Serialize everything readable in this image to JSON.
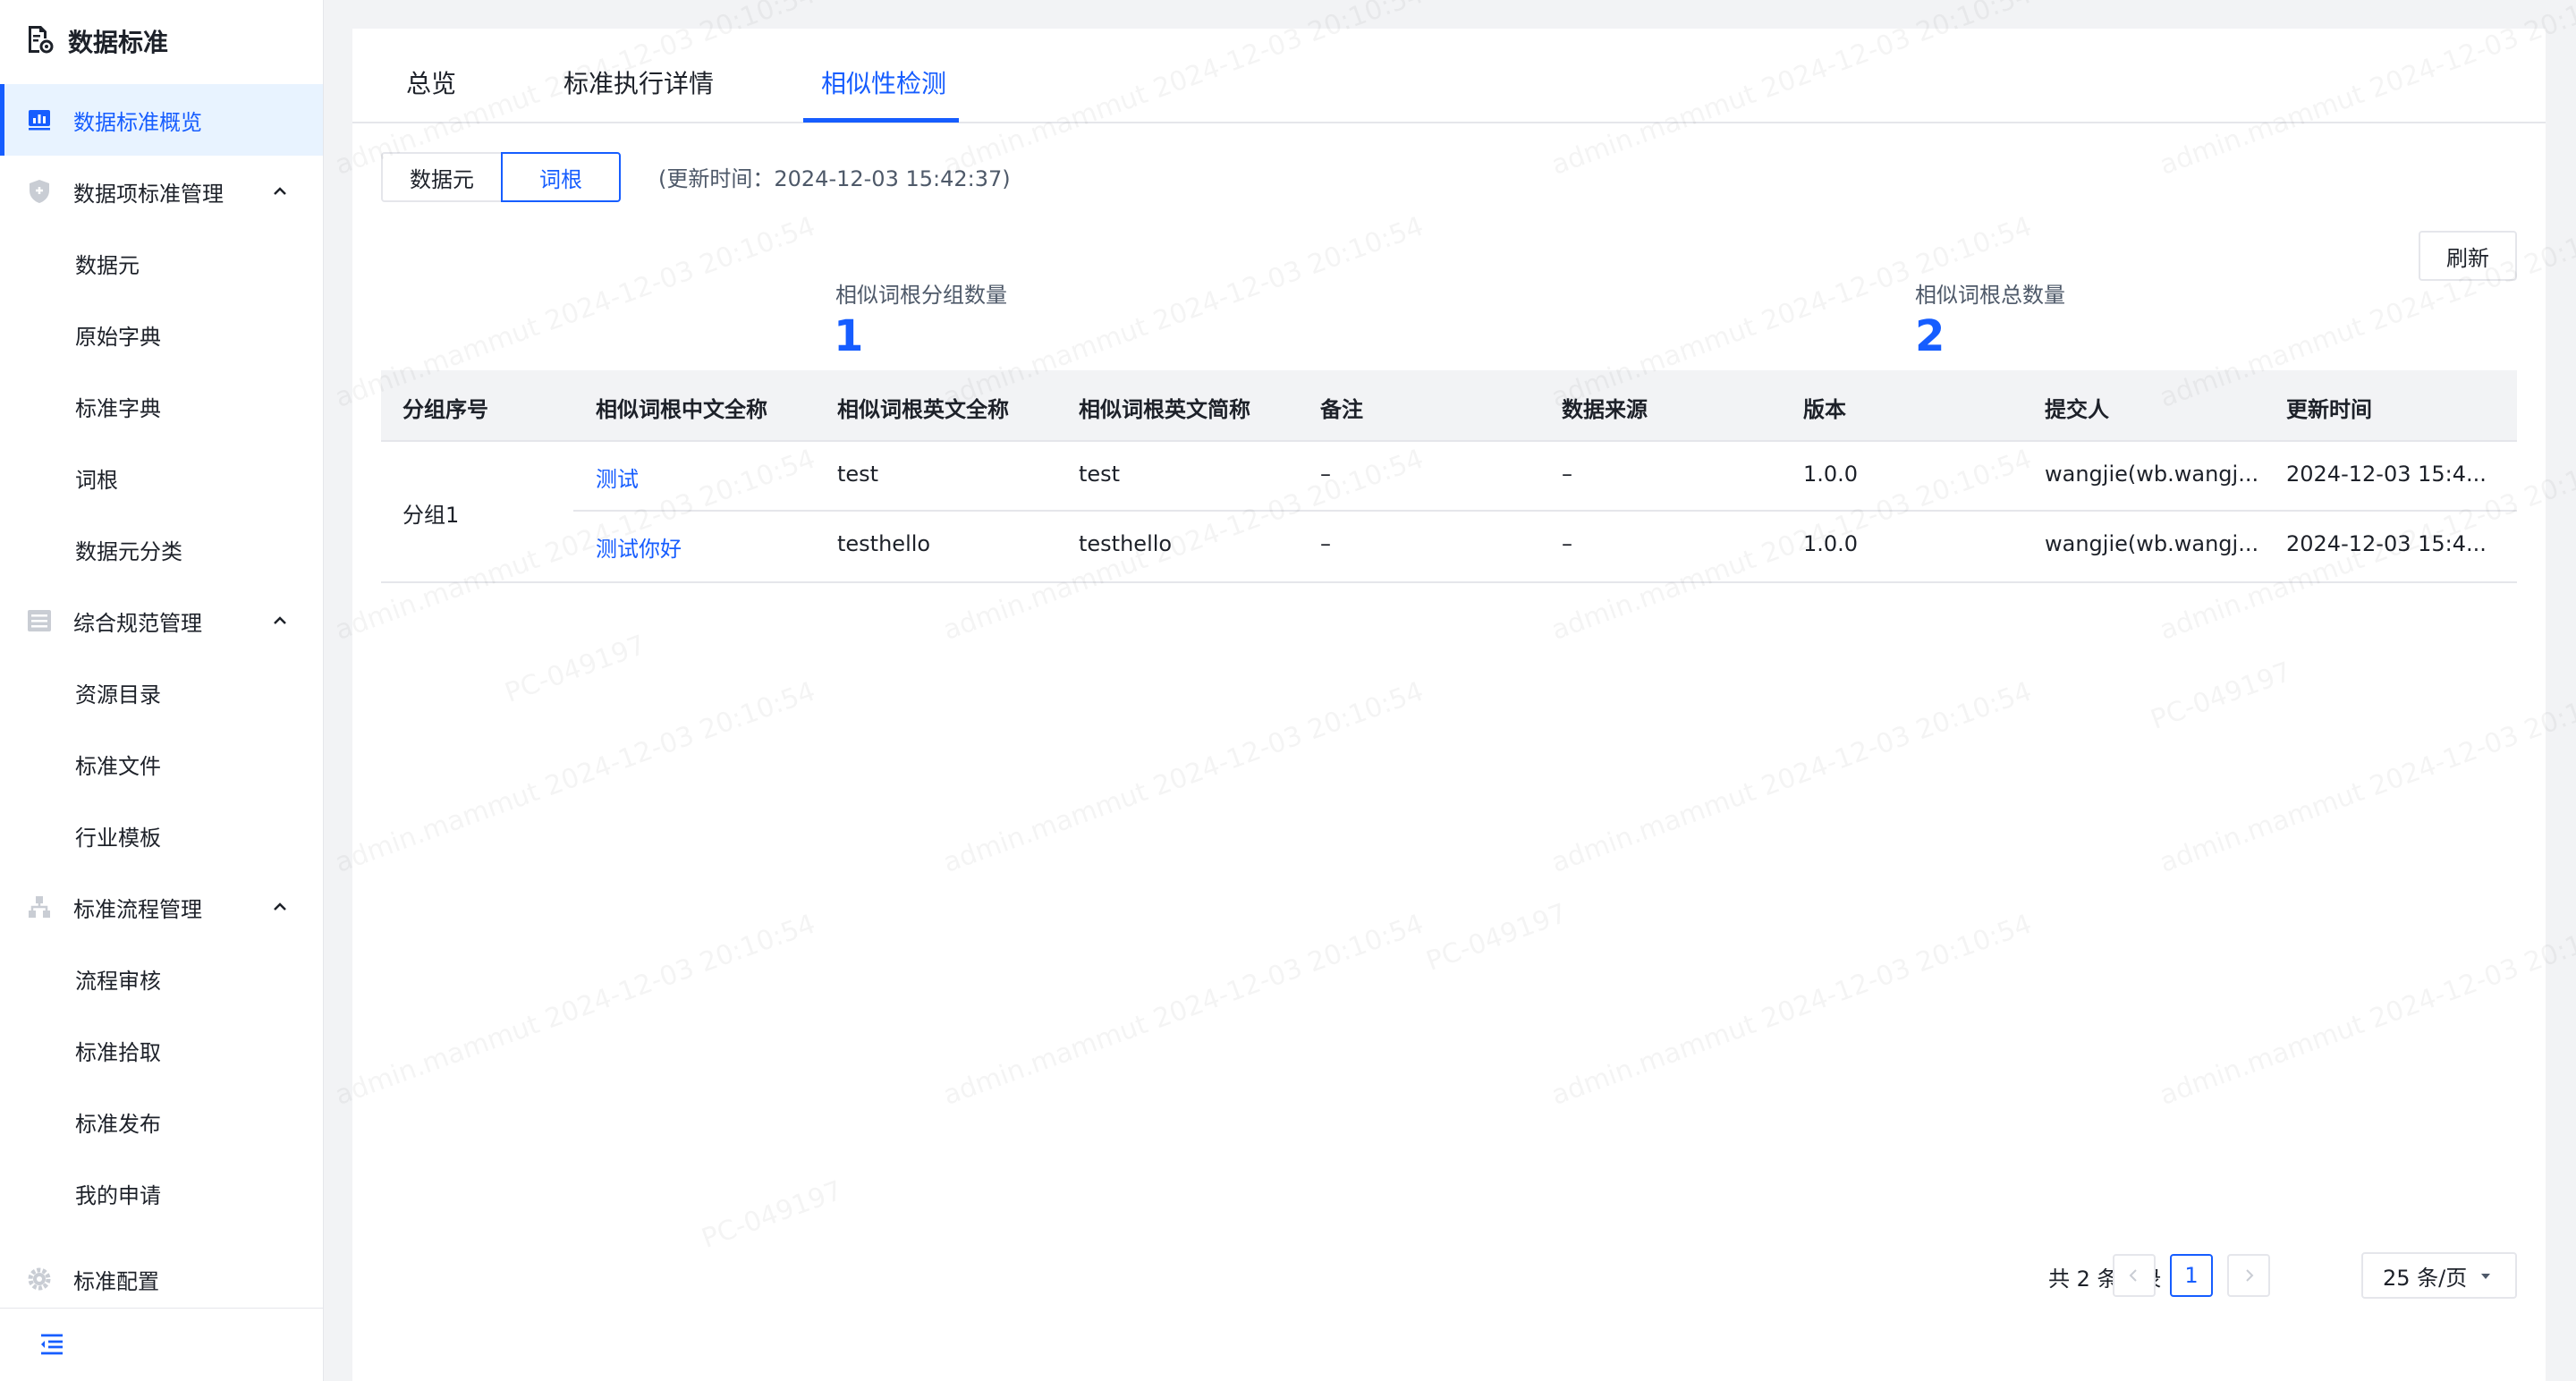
{
  "app": {
    "title": "数据标准"
  },
  "sidebar": {
    "items": [
      {
        "label": "数据标准概览",
        "type": "top",
        "icon": "chart-board-icon",
        "active": true
      },
      {
        "label": "数据项标准管理",
        "type": "group",
        "icon": "shield-icon"
      },
      {
        "label": "数据元",
        "type": "sub"
      },
      {
        "label": "原始字典",
        "type": "sub"
      },
      {
        "label": "标准字典",
        "type": "sub"
      },
      {
        "label": "词根",
        "type": "sub"
      },
      {
        "label": "数据元分类",
        "type": "sub"
      },
      {
        "label": "综合规范管理",
        "type": "group",
        "icon": "list-icon"
      },
      {
        "label": "资源目录",
        "type": "sub"
      },
      {
        "label": "标准文件",
        "type": "sub"
      },
      {
        "label": "行业模板",
        "type": "sub"
      },
      {
        "label": "标准流程管理",
        "type": "group",
        "icon": "flow-icon"
      },
      {
        "label": "流程审核",
        "type": "sub"
      },
      {
        "label": "标准拾取",
        "type": "sub"
      },
      {
        "label": "标准发布",
        "type": "sub"
      },
      {
        "label": "我的申请",
        "type": "sub"
      },
      {
        "label": "标准配置",
        "type": "top",
        "icon": "gear-icon"
      }
    ]
  },
  "tabs": [
    {
      "label": "总览"
    },
    {
      "label": "标准执行详情"
    },
    {
      "label": "相似性检测",
      "active": true
    }
  ],
  "segment": {
    "option_a": "数据元",
    "option_b": "词根"
  },
  "update_time": "(更新时间：2024-12-03 15:42:37)",
  "refresh_label": "刷新",
  "stats": {
    "group_count_label": "相似词根分组数量",
    "group_count_value": "1",
    "total_count_label": "相似词根总数量",
    "total_count_value": "2"
  },
  "table": {
    "headers": [
      "分组序号",
      "相似词根中文全称",
      "相似词根英文全称",
      "相似词根英文简称",
      "备注",
      "数据来源",
      "版本",
      "提交人",
      "更新时间"
    ],
    "group_label": "分组1",
    "rows": [
      [
        "测试",
        "test",
        "test",
        "–",
        "–",
        "1.0.0",
        "wangjie(wb.wangj...",
        "2024-12-03 15:4..."
      ],
      [
        "测试你好",
        "testhello",
        "testhello",
        "–",
        "–",
        "1.0.0",
        "wangjie(wb.wangj...",
        "2024-12-03 15:4..."
      ]
    ]
  },
  "pagination": {
    "total_text": "共 2 条记录",
    "current_page": "1",
    "page_size": "25 条/页"
  },
  "watermark": {
    "text": "admin.mammut 2024-12-03 20:10:54",
    "code": "PC-049197"
  },
  "colors": {
    "accent": "#165dff",
    "active_bg": "#e8f3ff",
    "page_bg": "#f2f3f5",
    "border": "#e5e6eb"
  }
}
